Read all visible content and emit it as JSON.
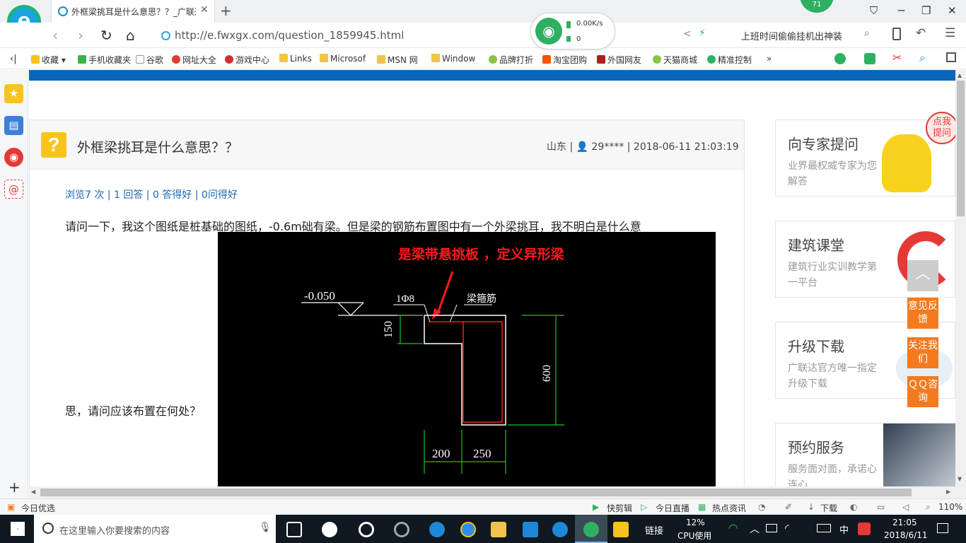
{
  "tab": {
    "title": "外框梁挑耳是什么意思？？_广联达",
    "close": "✕",
    "new_tab": "+"
  },
  "badge": "71",
  "window": {
    "minimize": "─",
    "restore": "❐",
    "close": "✕",
    "skin": "⛉"
  },
  "nav": {
    "back": "‹",
    "forward": "›",
    "reload": "↻",
    "home": "⌂",
    "url": "http://e.fwxgx.com/question_1859945.html",
    "search_text": "上班时间偷偷挂机出神装",
    "share": "<",
    "menu": "☰"
  },
  "speed": {
    "rate": "0.00K/s",
    "count": "0"
  },
  "bookmarks": [
    "收藏",
    "手机收藏夹",
    "谷歌",
    "网址大全",
    "游戏中心",
    "Links",
    "Microsof",
    "MSN 网",
    "Window",
    "品牌打折",
    "淘宝团购",
    "外国网友",
    "天猫商城",
    "精准控制"
  ],
  "bookmarks_more": "»",
  "question": {
    "icon": "?",
    "title": "外框梁挑耳是什么意思？？",
    "meta": "山东 | 👤 29**** | 2018-06-11 21:03:19",
    "stats": "浏览7 次 | 1 回答 | 0 答得好 | 0问得好",
    "body_line1": "请问一下，我这个图纸是桩基础的图纸，-0.6m础有梁。但是梁的钢筋布置图中有一个外梁挑耳，我不明白是什么意",
    "body_line2": "思，请问应该布置在何处？"
  },
  "cad": {
    "annotation": "是梁带悬挑板  ，定义异形梁",
    "elevation": "-0.050",
    "rebar": "1Φ8",
    "stirrup": "梁箍筋",
    "dim_150": "150",
    "dim_600": "600",
    "dim_200": "200",
    "dim_250": "250"
  },
  "right_cards": [
    {
      "title": "向专家提问",
      "sub": "业界最权威专家为您解答",
      "tag": "点我提问"
    },
    {
      "title": "建筑课堂",
      "sub": "建筑行业实训教学第一平台"
    },
    {
      "title": "升级下载",
      "sub": "广联达官方唯一指定升级下载"
    },
    {
      "title": "预约服务",
      "sub": "服务面对面，承诺心连心"
    }
  ],
  "float_buttons": [
    "意见反馈",
    "关注我们",
    "ＱＱ咨询"
  ],
  "statusbar": {
    "left": "今日优选",
    "items": [
      "快剪辑",
      "今日直播",
      "热点资讯",
      "下载"
    ],
    "zoom": "110%"
  },
  "taskbar": {
    "search_placeholder": "在这里输入你要搜索的内容",
    "link": "链接",
    "cpu_pct": "12%",
    "cpu_label": "CPU使用",
    "ime": "中",
    "time": "21:05",
    "date": "2018/6/11"
  },
  "colors": {
    "accent": "#0a66b8",
    "question_icon": "#f6c41c",
    "float_button": "#f37a1f",
    "link": "#1b68b3",
    "cad_red": "#ff1a1a",
    "cad_green": "#19c12f"
  }
}
